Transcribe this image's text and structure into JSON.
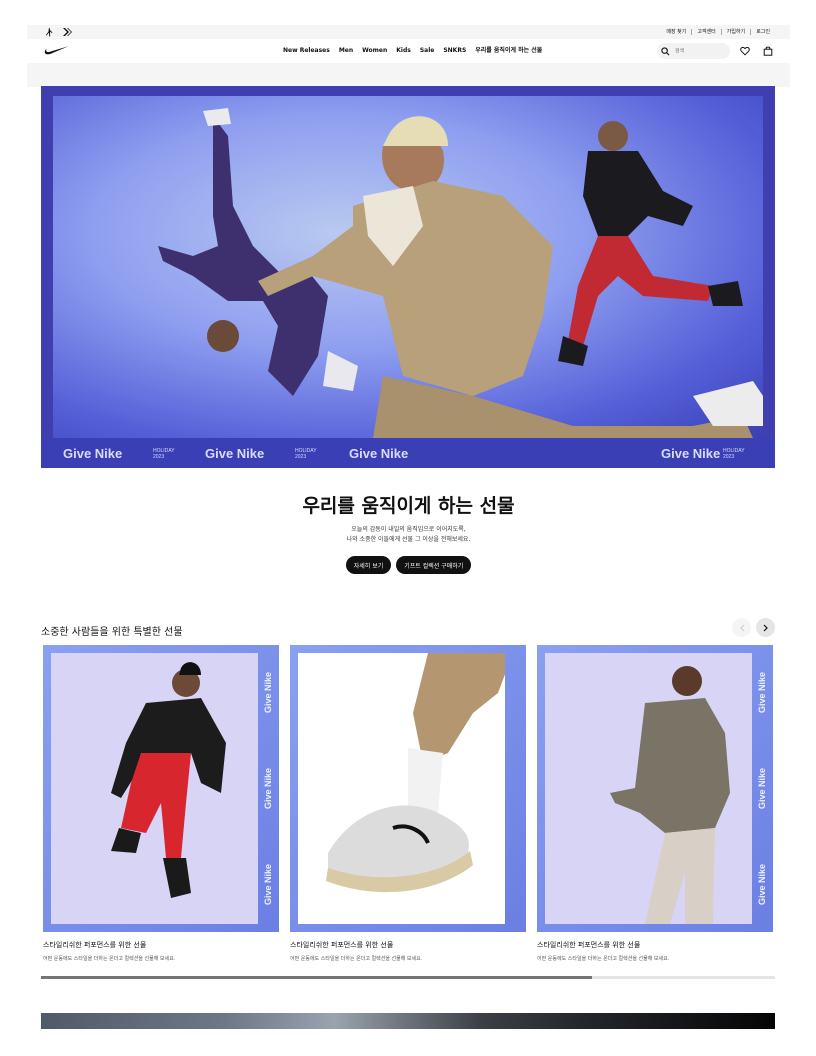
{
  "utility_bar": {
    "links": [
      "매장 찾기",
      "고객센터",
      "가입하기",
      "로그인"
    ]
  },
  "nav": {
    "items": [
      "New Releases",
      "Men",
      "Women",
      "Kids",
      "Sale",
      "SNKRS",
      "우리를 움직이게 하는 선물"
    ],
    "search_placeholder": "검색"
  },
  "icons": {
    "jordan": "jordan-jumpman-icon",
    "converse": "converse-chevron-icon",
    "logo": "nike-swoosh-icon",
    "search": "search-icon",
    "favorites": "heart-icon",
    "bag": "bag-icon",
    "prev": "chevron-left-icon",
    "next": "chevron-right-icon"
  },
  "hero": {
    "stamp_brand": "Give Nike",
    "stamp_holiday": "HOLIDAY",
    "stamp_year": "2023",
    "title": "우리를 움직이게 하는 선물",
    "subtitle_line1": "오늘의 감동이 내일의 움직임으로 이어지도록,",
    "subtitle_line2": "나와 소중한 이들에게 선물 그 이상을 전해보세요.",
    "button_1": "자세히 보기",
    "button_2": "기프트 컬렉션 구매하기"
  },
  "carousel": {
    "title": "소중한 사람들을 위한 특별한 선물",
    "cards": [
      {
        "title": "스타일리쉬한 퍼포먼스를 위한 선물",
        "desc": "어떤 운동에도 스타일을 더하는 온더고 컬렉션을 선물해 보세요."
      },
      {
        "title": "스타일리쉬한 퍼포먼스를 위한 선물",
        "desc": "어떤 운동에도 스타일을 더하는 온더고 컬렉션을 선물해 보세요."
      },
      {
        "title": "스타일리쉬한 퍼포먼스를 위한 선물",
        "desc": "어떤 운동에도 스타일을 더하는 온더고 컬렉션을 선물해 보세요."
      }
    ],
    "scroll_position": 0.75
  },
  "colors": {
    "accent": "#111111",
    "hero_blue": "#3f3fb0",
    "card_frame": "#7a8de8"
  }
}
